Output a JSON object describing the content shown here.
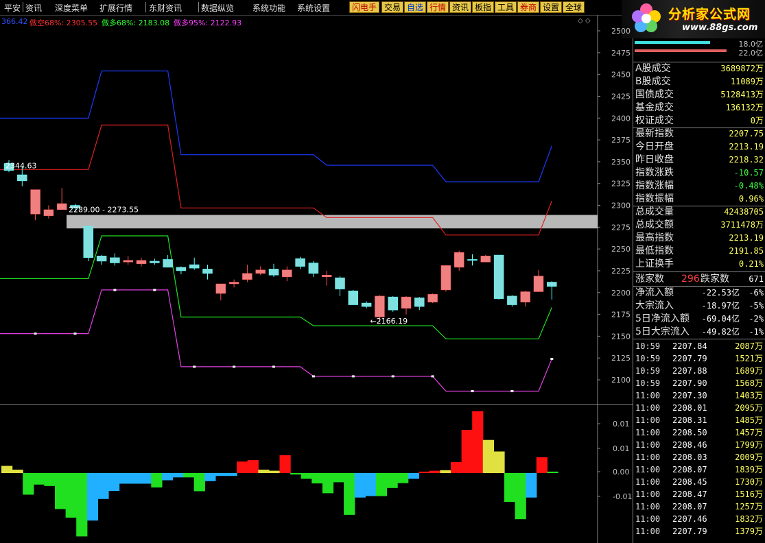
{
  "menu": {
    "items": [
      "平安",
      "资讯",
      "深度菜单",
      "扩展行情",
      "东财资讯",
      "数据纵览",
      "系统功能",
      "系统设置"
    ],
    "toolbar": [
      "闪电手",
      "交易",
      "自选",
      "行情",
      "资讯",
      "板指",
      "工具",
      "券商",
      "设置",
      "全球"
    ]
  },
  "logo": {
    "title": "分析家公式网",
    "url": "www.88gs.com"
  },
  "legend": [
    {
      "text": "366.42",
      "color": "#3050ff"
    },
    {
      "text": "做空68%: 2305.55",
      "color": "#ff3030"
    },
    {
      "text": "做多68%: 2183.08",
      "color": "#30ff30"
    },
    {
      "text": "做多95%: 2122.93",
      "color": "#ff40ff"
    }
  ],
  "price_axis": [
    "2500",
    "2475",
    "2450",
    "2425",
    "2400",
    "2375",
    "2350",
    "2325",
    "2300",
    "2275",
    "2250",
    "2225",
    "2200",
    "2175",
    "2150",
    "2125",
    "2100"
  ],
  "osc_axis": [
    "0.01",
    "0.01",
    "0.00",
    "-0.01"
  ],
  "annotations": {
    "high": "2344.63",
    "band": "2289.00 - 2273.55",
    "low": "2166.19"
  },
  "chart_data": {
    "type": "candlestick",
    "ylim": [
      2090,
      2510
    ],
    "candles": [
      {
        "o": 2348,
        "c": 2340,
        "h": 2352,
        "l": 2338
      },
      {
        "o": 2335,
        "c": 2328,
        "h": 2345,
        "l": 2322
      },
      {
        "o": 2290,
        "c": 2318,
        "h": 2318,
        "l": 2283
      },
      {
        "o": 2288,
        "c": 2295,
        "h": 2300,
        "l": 2285
      },
      {
        "o": 2295,
        "c": 2302,
        "h": 2320,
        "l": 2295
      },
      {
        "o": 2300,
        "c": 2297,
        "h": 2302,
        "l": 2292
      },
      {
        "o": 2276,
        "c": 2240,
        "h": 2276,
        "l": 2236
      },
      {
        "o": 2242,
        "c": 2236,
        "h": 2243,
        "l": 2232
      },
      {
        "o": 2240,
        "c": 2234,
        "h": 2245,
        "l": 2231
      },
      {
        "o": 2235,
        "c": 2237,
        "h": 2242,
        "l": 2232
      },
      {
        "o": 2233,
        "c": 2237,
        "h": 2240,
        "l": 2230
      },
      {
        "o": 2236,
        "c": 2234,
        "h": 2239,
        "l": 2232
      },
      {
        "o": 2238,
        "c": 2229,
        "h": 2243,
        "l": 2229
      },
      {
        "o": 2229,
        "c": 2225,
        "h": 2230,
        "l": 2221
      },
      {
        "o": 2232,
        "c": 2228,
        "h": 2240,
        "l": 2226
      },
      {
        "o": 2227,
        "c": 2222,
        "h": 2232,
        "l": 2215
      },
      {
        "o": 2199,
        "c": 2210,
        "h": 2210,
        "l": 2191
      },
      {
        "o": 2210,
        "c": 2212,
        "h": 2215,
        "l": 2206
      },
      {
        "o": 2215,
        "c": 2222,
        "h": 2232,
        "l": 2212
      },
      {
        "o": 2222,
        "c": 2226,
        "h": 2230,
        "l": 2220
      },
      {
        "o": 2227,
        "c": 2220,
        "h": 2233,
        "l": 2218
      },
      {
        "o": 2218,
        "c": 2226,
        "h": 2230,
        "l": 2213
      },
      {
        "o": 2239,
        "c": 2230,
        "h": 2241,
        "l": 2227
      },
      {
        "o": 2234,
        "c": 2222,
        "h": 2236,
        "l": 2218
      },
      {
        "o": 2218,
        "c": 2220,
        "h": 2225,
        "l": 2208
      },
      {
        "o": 2217,
        "c": 2204,
        "h": 2219,
        "l": 2196
      },
      {
        "o": 2202,
        "c": 2186,
        "h": 2203,
        "l": 2186
      },
      {
        "o": 2188,
        "c": 2184,
        "h": 2190,
        "l": 2182
      },
      {
        "o": 2172,
        "c": 2196,
        "h": 2197,
        "l": 2166
      },
      {
        "o": 2195,
        "c": 2180,
        "h": 2196,
        "l": 2178
      },
      {
        "o": 2182,
        "c": 2195,
        "h": 2196,
        "l": 2175
      },
      {
        "o": 2194,
        "c": 2184,
        "h": 2195,
        "l": 2180
      },
      {
        "o": 2189,
        "c": 2198,
        "h": 2199,
        "l": 2188
      },
      {
        "o": 2203,
        "c": 2231,
        "h": 2231,
        "l": 2201
      },
      {
        "o": 2229,
        "c": 2246,
        "h": 2248,
        "l": 2225
      },
      {
        "o": 2238,
        "c": 2237,
        "h": 2244,
        "l": 2231
      },
      {
        "o": 2235,
        "c": 2242,
        "h": 2243,
        "l": 2235
      },
      {
        "o": 2243,
        "c": 2193,
        "h": 2243,
        "l": 2192
      },
      {
        "o": 2196,
        "c": 2186,
        "h": 2197,
        "l": 2184
      },
      {
        "o": 2189,
        "c": 2201,
        "h": 2202,
        "l": 2184
      },
      {
        "o": 2201,
        "c": 2219,
        "h": 2226,
        "l": 2201
      },
      {
        "o": 2212,
        "c": 2207,
        "h": 2213,
        "l": 2192
      }
    ],
    "lines": [
      {
        "color": "#1a3bff",
        "points": [
          [
            0,
            2400
          ],
          [
            6,
            2400
          ],
          [
            7,
            2454
          ],
          [
            12,
            2454
          ],
          [
            13,
            2358
          ],
          [
            23,
            2358
          ],
          [
            24,
            2346
          ],
          [
            32,
            2346
          ],
          [
            33,
            2327
          ],
          [
            40,
            2327
          ],
          [
            41,
            2368
          ]
        ]
      },
      {
        "color": "#e02020",
        "points": [
          [
            0,
            2341
          ],
          [
            6,
            2341
          ],
          [
            7,
            2392
          ],
          [
            12,
            2392
          ],
          [
            13,
            2297
          ],
          [
            23,
            2297
          ],
          [
            24,
            2286
          ],
          [
            32,
            2286
          ],
          [
            33,
            2266
          ],
          [
            40,
            2266
          ],
          [
            41,
            2305
          ]
        ]
      },
      {
        "color": "#20e020",
        "points": [
          [
            0,
            2216
          ],
          [
            6,
            2216
          ],
          [
            7,
            2265
          ],
          [
            12,
            2265
          ],
          [
            13,
            2172
          ],
          [
            22,
            2172
          ],
          [
            23,
            2162
          ],
          [
            32,
            2162
          ],
          [
            33,
            2147
          ],
          [
            40,
            2147
          ],
          [
            41,
            2183
          ]
        ]
      },
      {
        "color": "#e040e0",
        "points": [
          [
            0,
            2153
          ],
          [
            6,
            2153
          ],
          [
            7,
            2203
          ],
          [
            12,
            2203
          ],
          [
            13,
            2115
          ],
          [
            22,
            2115
          ],
          [
            23,
            2104
          ],
          [
            32,
            2104
          ],
          [
            33,
            2087
          ],
          [
            40,
            2087
          ],
          [
            41,
            2124
          ]
        ]
      }
    ],
    "markers_pink": [
      2,
      5,
      8,
      11,
      14,
      17,
      20,
      23,
      26,
      29,
      32,
      35,
      38,
      41
    ],
    "osc_ylim": [
      -0.025,
      0.018
    ],
    "osc_bars": [
      0.0025,
      0.0012,
      -0.0075,
      -0.004,
      -0.0045,
      -0.0125,
      -0.0155,
      -0.022,
      -0.0165,
      -0.009,
      -0.0062,
      -0.0037,
      -0.0037,
      -0.0037,
      -0.005,
      -0.0025,
      -0.0015,
      -0.0015,
      -0.0063,
      -0.0028,
      -0.001,
      -0.001,
      0.004,
      0.0045,
      0.0012,
      0.0008,
      0.0062,
      -0.0005,
      -0.002,
      -0.0036,
      -0.007,
      -0.0032,
      -0.0145,
      -0.0085,
      -0.008,
      -0.008,
      -0.0052,
      -0.0035,
      -0.002,
      0.0005,
      0.0008,
      0.001,
      0.0038,
      0.015,
      0.0215,
      0.0115,
      0.0075,
      -0.01,
      -0.016,
      -0.0085,
      0.0055,
      0.0005
    ],
    "osc_colors": [
      "#e0e040",
      "#e0e040",
      "#20e020",
      "#20e020",
      "#20e020",
      "#20e020",
      "#20e020",
      "#20e020",
      "#20b0ff",
      "#20b0ff",
      "#20b0ff",
      "#20b0ff",
      "#20b0ff",
      "#20b0ff",
      "#20e020",
      "#20b0ff",
      "#20b0ff",
      "#20e020",
      "#20e020",
      "#20b0ff",
      "#20b0ff",
      "#20b0ff",
      "#ff1010",
      "#ff1010",
      "#e0e040",
      "#e0e040",
      "#ff1010",
      "#20e020",
      "#20e020",
      "#20e020",
      "#20e020",
      "#20e020",
      "#20e020",
      "#20b0ff",
      "#20b0ff",
      "#20e020",
      "#20e020",
      "#20e020",
      "#20b0ff",
      "#ff1010",
      "#ff1010",
      "#e0e040",
      "#ff1010",
      "#ff1010",
      "#ff1010",
      "#e0e040",
      "#e0e040",
      "#20e020",
      "#20e020",
      "#20b0ff",
      "#ff1010",
      "#20e020"
    ]
  },
  "right_panel": {
    "bars_label": [
      "18.0亿",
      "22.0亿"
    ],
    "stats": [
      {
        "label": "A股成交",
        "value": "3689872万"
      },
      {
        "label": "B股成交",
        "value": "11089万"
      },
      {
        "label": "国债成交",
        "value": "5128413万"
      },
      {
        "label": "基金成交",
        "value": "136132万"
      },
      {
        "label": "权证成交",
        "value": "0万"
      },
      {
        "label": "最新指数",
        "value": "2207.75"
      },
      {
        "label": "今日开盘",
        "value": "2213.19"
      },
      {
        "label": "昨日收盘",
        "value": "2218.32"
      },
      {
        "label": "指数涨跌",
        "value": "-10.57"
      },
      {
        "label": "指数涨幅",
        "value": "-0.48%"
      },
      {
        "label": "指数振幅",
        "value": "0.96%"
      },
      {
        "label": "总成交量",
        "value": "42438705"
      },
      {
        "label": "总成交额",
        "value": "3711478万"
      },
      {
        "label": "最高指数",
        "value": "2213.19"
      },
      {
        "label": "最低指数",
        "value": "2191.85"
      },
      {
        "label": "上证换手",
        "value": "0.21%"
      }
    ],
    "updown": {
      "up_label": "涨家数",
      "up": "296",
      "down_label": "跌家数",
      "down": "671"
    },
    "flows": [
      {
        "label": "净流入额",
        "value": "-22.53亿",
        "pct": "-6%"
      },
      {
        "label": "大宗流入",
        "value": "-18.97亿",
        "pct": "-5%"
      },
      {
        "label": "5日净流入额",
        "value": "-69.04亿",
        "pct": "-2%"
      },
      {
        "label": "5日大宗流入",
        "value": "-49.82亿",
        "pct": "-1%"
      }
    ],
    "ticks": [
      {
        "t": "10:59",
        "p": "2207.84",
        "v": "2087万"
      },
      {
        "t": "10:59",
        "p": "2207.79",
        "v": "1521万"
      },
      {
        "t": "10:59",
        "p": "2207.88",
        "v": "1689万"
      },
      {
        "t": "10:59",
        "p": "2207.90",
        "v": "1568万"
      },
      {
        "t": "11:00",
        "p": "2207.30",
        "v": "1403万"
      },
      {
        "t": "11:00",
        "p": "2208.01",
        "v": "2095万"
      },
      {
        "t": "11:00",
        "p": "2208.31",
        "v": "1485万"
      },
      {
        "t": "11:00",
        "p": "2208.50",
        "v": "1457万"
      },
      {
        "t": "11:00",
        "p": "2208.46",
        "v": "1799万"
      },
      {
        "t": "11:00",
        "p": "2208.03",
        "v": "2009万"
      },
      {
        "t": "11:00",
        "p": "2208.07",
        "v": "1839万"
      },
      {
        "t": "11:00",
        "p": "2208.45",
        "v": "1730万"
      },
      {
        "t": "11:00",
        "p": "2208.47",
        "v": "1516万"
      },
      {
        "t": "11:00",
        "p": "2208.07",
        "v": "1257万"
      },
      {
        "t": "11:00",
        "p": "2207.46",
        "v": "1832万"
      },
      {
        "t": "11:00",
        "p": "2207.79",
        "v": "1379万"
      }
    ]
  }
}
